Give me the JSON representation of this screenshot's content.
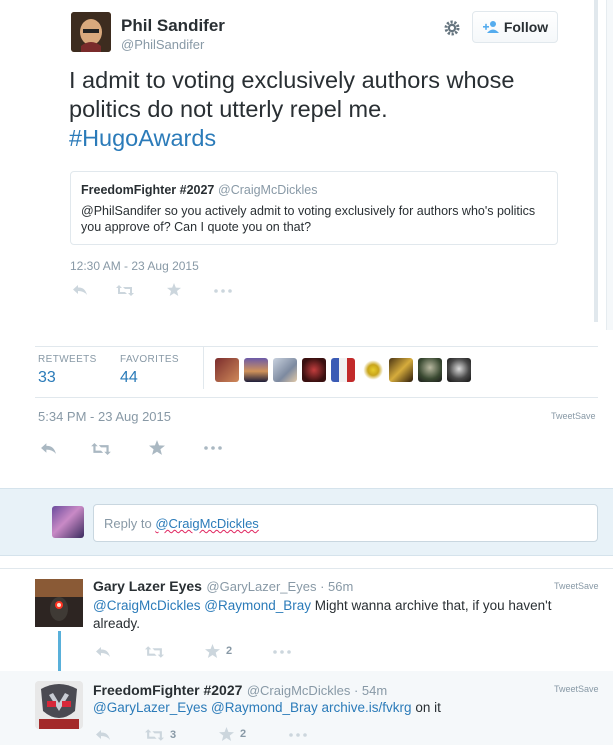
{
  "embed": {
    "author_name": "Phil Sandifer",
    "author_handle": "@PhilSandifer",
    "follow_label": "Follow",
    "tweet_text_line1": "I admit to voting exclusively authors whose",
    "tweet_text_line2": "politics do not utterly repel me.",
    "hashtag": "#HugoAwards",
    "quote": {
      "name": "FreedomFighter #2027",
      "handle": "@CraigMcDickles",
      "text": "@PhilSandifer so you actively admit to voting exclusively for authors who's politics you approve of? Can I quote you on that?"
    },
    "timestamp": "12:30 AM - 23 Aug 2015"
  },
  "stats": {
    "retweets_label": "RETWEETS",
    "retweets_value": "33",
    "favorites_label": "FAVORITES",
    "favorites_value": "44"
  },
  "main": {
    "timestamp": "5:34 PM - 23 Aug 2015",
    "tweetsave": "TweetSave"
  },
  "reply_box": {
    "prefix": "Reply to ",
    "mention": "@CraigMcDickles"
  },
  "replies": [
    {
      "name": "Gary Lazer Eyes",
      "handle": "@GaryLazer_Eyes",
      "time": "56m",
      "tweetsave": "TweetSave",
      "mention1": "@CraigMcDickles",
      "mention2": "@Raymond_Bray",
      "text_line1_rest": "Might wanna archive that, if you haven't",
      "text_line2": "already.",
      "retweets": "",
      "favorites": "2"
    },
    {
      "name": "FreedomFighter #2027",
      "handle": "@CraigMcDickles",
      "time": "54m",
      "tweetsave": "TweetSave",
      "mention1": "@GaryLazer_Eyes",
      "mention2": "@Raymond_Bray",
      "link": "archive.is/fvkrg",
      "text_rest": "on it",
      "retweets": "3",
      "favorites": "2"
    }
  ],
  "separator": " · ",
  "colors": {
    "link_blue": "#2b7bb9",
    "grey": "#8899a6",
    "reply_band": "#e8f2f8",
    "thread_line": "#59b0da"
  }
}
